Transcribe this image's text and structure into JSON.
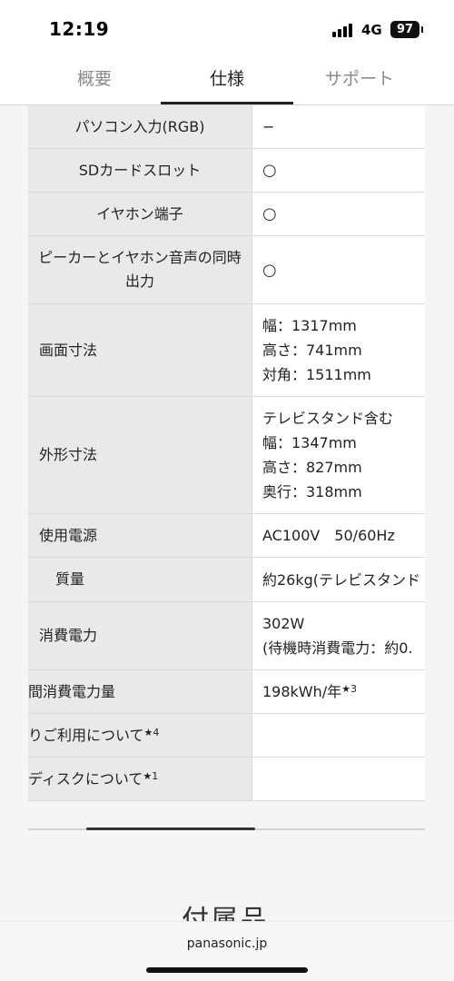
{
  "status_bar": {
    "time": "12:19",
    "network": "4G",
    "battery": "97"
  },
  "tabs": [
    {
      "label": "概要",
      "active": false
    },
    {
      "label": "仕様",
      "active": true
    },
    {
      "label": "サポート",
      "active": false
    }
  ],
  "specs": {
    "pc_input": {
      "label": "パソコン入力(RGB)",
      "value": "−"
    },
    "sd_slot": {
      "label": "SDカードスロット",
      "value": "○"
    },
    "earphone": {
      "label": "イヤホン端子",
      "value": "○"
    },
    "simultaneous_output": {
      "label": "ピーカーとイヤホン音声の同時出力",
      "value": "○"
    },
    "screen_size": {
      "label": "画面寸法",
      "lines": [
        "幅：1317mm",
        "高さ：741mm",
        "対角：1511mm"
      ]
    },
    "outer_size": {
      "label": "外形寸法",
      "lines": [
        "テレビスタンド含む",
        "幅：1347mm",
        "高さ：827mm",
        "奥行：318mm"
      ]
    },
    "power_source": {
      "label": "使用電源",
      "value": "AC100V　50/60Hz"
    },
    "mass": {
      "label": "質量",
      "value": "約26kg(テレビスタンド"
    },
    "power_consumption": {
      "label": "消費電力",
      "lines": [
        "302W",
        "(待機時消費電力：約0."
      ]
    },
    "annual_power": {
      "label": "間消費電力量",
      "value": "198kWh/年",
      "note": "★3"
    },
    "usage": {
      "label": "りご利用について",
      "note": "★4"
    },
    "disc": {
      "label": "ディスクについて",
      "note": "★1"
    }
  },
  "next_section": {
    "heading": "付属品"
  },
  "browser": {
    "url": "panasonic.jp"
  }
}
